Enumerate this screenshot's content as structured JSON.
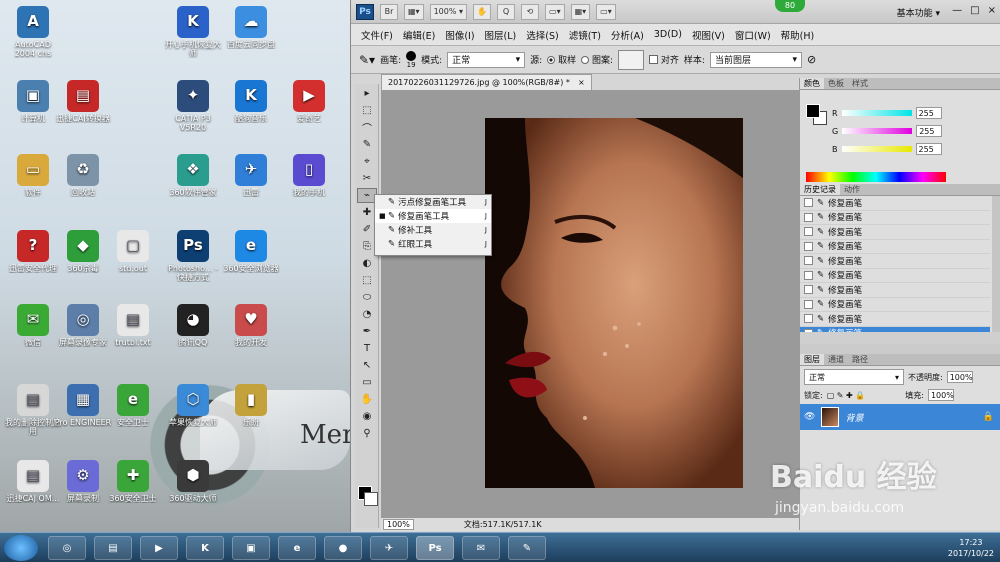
{
  "desktop": {
    "icons": [
      {
        "label": "AutoCAD 2004 chs",
        "color": "#2e74b5",
        "glyph": "A"
      },
      {
        "label": "开心手机恢复大师",
        "color": "#2a62c9",
        "glyph": "K"
      },
      {
        "label": "百度云同步盘",
        "color": "#3b8ee0",
        "glyph": "☁"
      },
      {
        "label": "计算机",
        "color": "#4a7fb0",
        "glyph": "▣"
      },
      {
        "label": "迅捷CAJ转换器",
        "color": "#c62828",
        "glyph": "▤"
      },
      {
        "label": "CATIA P3 V5R20",
        "color": "#2c4c7c",
        "glyph": "✦"
      },
      {
        "label": "酷狗音乐",
        "color": "#1976d2",
        "glyph": "K"
      },
      {
        "label": "爱奇艺",
        "color": "#d32f2f",
        "glyph": "▶"
      },
      {
        "label": "软件",
        "color": "#d9a93b",
        "glyph": "▭"
      },
      {
        "label": "回收站",
        "color": "#7c93a8",
        "glyph": "♻"
      },
      {
        "label": "360软件管家",
        "color": "#2a9d8f",
        "glyph": "❖"
      },
      {
        "label": "迅雷",
        "color": "#2f7fd8",
        "glyph": "✈"
      },
      {
        "label": "我的手机",
        "color": "#5b4bd1",
        "glyph": "▯"
      },
      {
        "label": "迅雷安全代理",
        "color": "#c62828",
        "glyph": "?"
      },
      {
        "label": "360杀毒",
        "color": "#2e9e3b",
        "glyph": "◆"
      },
      {
        "label": "std.out",
        "color": "#e8e8e8",
        "glyph": "▢"
      },
      {
        "label": "Photosho... - 快捷方式",
        "color": "#0d3f73",
        "glyph": "Ps"
      },
      {
        "label": "360安全浏览器",
        "color": "#1e88e5",
        "glyph": "e"
      },
      {
        "label": "微信",
        "color": "#3aaa35",
        "glyph": "✉"
      },
      {
        "label": "屏幕录像专家",
        "color": "#5c7ea8",
        "glyph": "◎"
      },
      {
        "label": "trutbl.txt",
        "color": "#e8e8e8",
        "glyph": "▤"
      },
      {
        "label": "腾讯QQ",
        "color": "#222222",
        "glyph": "◕"
      },
      {
        "label": "我的开发",
        "color": "#c94b4b",
        "glyph": "♥"
      },
      {
        "label": "我的删除控制应用",
        "color": "#d7d7d7",
        "glyph": "▤"
      },
      {
        "label": "Pro ENGINEER",
        "color": "#3d6fb0",
        "glyph": "▦"
      },
      {
        "label": "安全卫士",
        "color": "#3aa63a",
        "glyph": "e"
      },
      {
        "label": "苹果恢复大师",
        "color": "#3a8ad8",
        "glyph": "⬡"
      },
      {
        "label": "乐盼",
        "color": "#c4a23b",
        "glyph": "▮"
      },
      {
        "label": "迅捷CAJ OM...",
        "color": "#e8e8e8",
        "glyph": "▤"
      },
      {
        "label": "屏幕录制",
        "color": "#6b6bd8",
        "glyph": "⚙"
      },
      {
        "label": "360安全卫士",
        "color": "#3aa63a",
        "glyph": "✚"
      },
      {
        "label": "360驱动大师",
        "color": "#3a3a3a",
        "glyph": "⬢"
      }
    ],
    "background_text": "Mer"
  },
  "photoshop": {
    "logo": "Ps",
    "title_buttons": [
      "Br",
      "▦▾",
      "100% ▾",
      "✋",
      "Q",
      "⟲",
      "▭▾",
      "▦▾",
      "▭▾"
    ],
    "badge": "80",
    "workspace": "基本功能 ▾",
    "window_controls": [
      "—",
      "□",
      "×"
    ],
    "menus": [
      "文件(F)",
      "编辑(E)",
      "图像(I)",
      "图层(L)",
      "选择(S)",
      "滤镜(T)",
      "分析(A)",
      "3D(D)",
      "视图(V)",
      "窗口(W)",
      "帮助(H)"
    ],
    "options": {
      "brush_label": "画笔:",
      "brush_size": "19",
      "mode_label": "模式:",
      "mode_value": "正常",
      "source_label": "源:",
      "sampled": "取样",
      "pattern": "图案:",
      "aligned": "对齐",
      "sample_label": "样本:",
      "sample_value": "当前图层"
    },
    "tools": [
      "▸",
      "⬚",
      "⌒",
      "✎",
      "⌖",
      "✂",
      "⌁",
      "✚",
      "✐",
      "⎘",
      "◐",
      "⬚",
      "⬭",
      "◔",
      "✒",
      "T",
      "↖",
      "▭",
      "✋",
      "◉",
      "⚲"
    ],
    "flyout": [
      {
        "label": "污点修复画笔工具",
        "key": "J",
        "selected": false
      },
      {
        "label": "修复画笔工具",
        "key": "J",
        "selected": true
      },
      {
        "label": "修补工具",
        "key": "J",
        "selected": false
      },
      {
        "label": "红眼工具",
        "key": "J",
        "selected": false
      }
    ],
    "document": {
      "tab_title": "20170226031129726.jpg @ 100%(RGB/8#) *",
      "close": "×",
      "zoom": "100%",
      "doc_info": "文档:517.1K/517.1K"
    },
    "color_panel": {
      "tabs": [
        "颜色",
        "色板",
        "样式"
      ],
      "channels": [
        {
          "name": "R",
          "value": "255",
          "color": "#00e5e5"
        },
        {
          "name": "G",
          "value": "255",
          "color": "#e000e0"
        },
        {
          "name": "B",
          "value": "255",
          "color": "#e8e800"
        }
      ]
    },
    "history_panel": {
      "tabs": [
        "历史记录",
        "动作"
      ],
      "items": [
        "修复画笔",
        "修复画笔",
        "修复画笔",
        "修复画笔",
        "修复画笔",
        "修复画笔",
        "修复画笔",
        "修复画笔",
        "修复画笔",
        "修复画笔"
      ]
    },
    "layers_panel": {
      "tabs": [
        "图层",
        "通道",
        "路径"
      ],
      "blend": "正常",
      "opacity_label": "不透明度:",
      "opacity": "100%",
      "lock_label": "锁定:",
      "fill_label": "填充:",
      "fill": "100%",
      "layer_name": "背景"
    }
  },
  "taskbar": {
    "apps": [
      "◎",
      "▤",
      "▶",
      "K",
      "▣",
      "e",
      "●",
      "✈",
      "Ps",
      "✉",
      "✎"
    ],
    "time": "17:23",
    "date": "2017/10/22"
  },
  "watermark": {
    "main": "Baidu 经验",
    "sub": "jingyan.baidu.com"
  }
}
